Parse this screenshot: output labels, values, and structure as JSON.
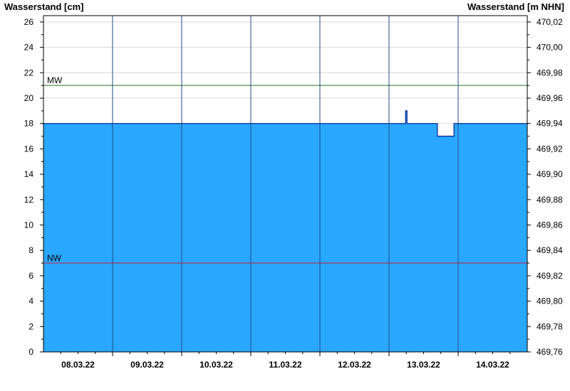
{
  "chart_data": {
    "type": "area",
    "ylabel": "Wasserstand [cm]",
    "y2label": "Wasserstand [m NHN]",
    "ylim": [
      0,
      26.5
    ],
    "y_ticks": [
      0,
      2,
      4,
      6,
      8,
      10,
      12,
      14,
      16,
      18,
      20,
      22,
      24,
      26
    ],
    "y2_ticks": [
      {
        "v": 0,
        "label": "469,76"
      },
      {
        "v": 2,
        "label": "469,78"
      },
      {
        "v": 4,
        "label": "469,80"
      },
      {
        "v": 6,
        "label": "469,82"
      },
      {
        "v": 8,
        "label": "469,84"
      },
      {
        "v": 10,
        "label": "469,86"
      },
      {
        "v": 12,
        "label": "469,88"
      },
      {
        "v": 14,
        "label": "469,90"
      },
      {
        "v": 16,
        "label": "469,92"
      },
      {
        "v": 18,
        "label": "469,94"
      },
      {
        "v": 20,
        "label": "469,96"
      },
      {
        "v": 22,
        "label": "469,98"
      },
      {
        "v": 24,
        "label": "470,00"
      },
      {
        "v": 26,
        "label": "470,02"
      }
    ],
    "xlim": [
      7.5,
      14.5
    ],
    "x_days": [
      {
        "x": 8,
        "label": "08.03.22"
      },
      {
        "x": 9,
        "label": "09.03.22"
      },
      {
        "x": 10,
        "label": "10.03.22"
      },
      {
        "x": 11,
        "label": "11.03.22"
      },
      {
        "x": 12,
        "label": "12.03.22"
      },
      {
        "x": 13,
        "label": "13.03.22"
      },
      {
        "x": 14,
        "label": "14.03.22"
      }
    ],
    "day_boundaries": [
      8.5,
      9.5,
      10.5,
      11.5,
      12.5,
      13.5
    ],
    "series": [
      {
        "x": [
          7.5,
          12.73,
          12.74,
          12.74,
          12.76,
          12.76,
          12.77,
          13.2,
          13.2,
          13.44,
          13.44,
          14.5
        ],
        "y": [
          18,
          18,
          18,
          19,
          19,
          18,
          18,
          18,
          17,
          17,
          18,
          18
        ]
      }
    ],
    "reference_lines": [
      {
        "label": "MW",
        "value": 21,
        "color": "#1a7a1a"
      },
      {
        "label": "NW",
        "value": 7,
        "color": "#c0203a"
      }
    ],
    "fill_color": "#2aa7ff",
    "line_color": "#0a2f9a",
    "grid": true
  }
}
